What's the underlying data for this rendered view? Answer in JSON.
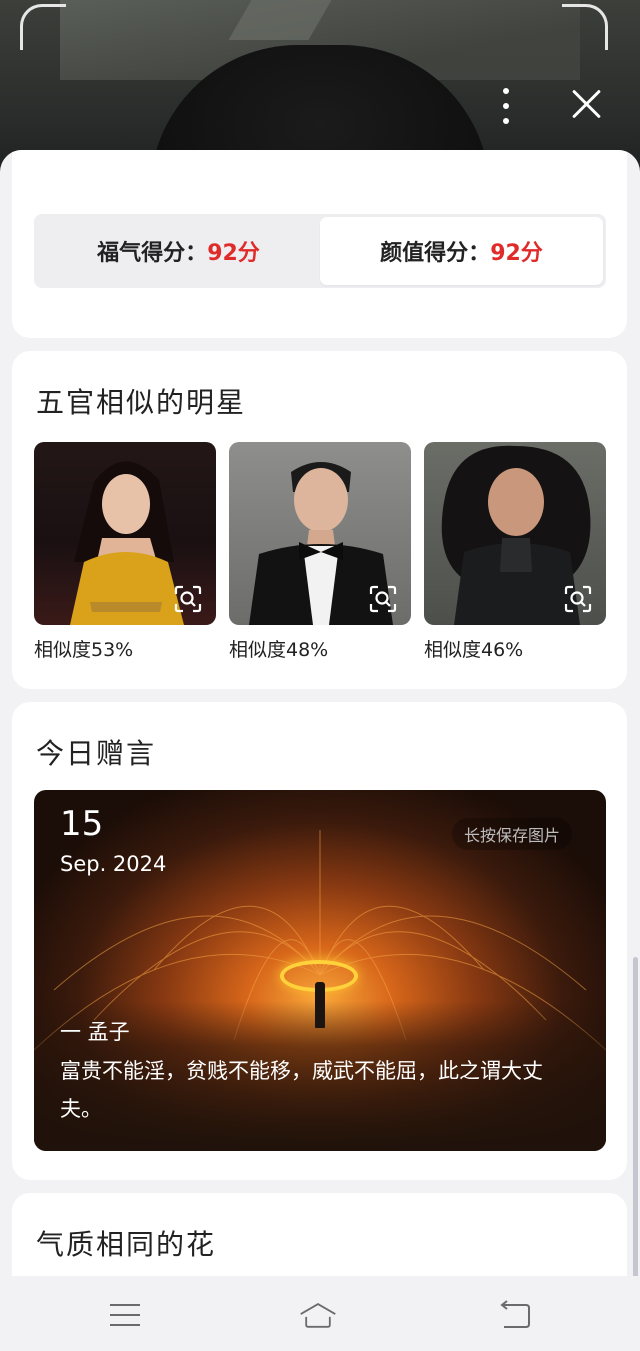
{
  "scores": {
    "fortune": {
      "label": "福气得分：",
      "value": "92分"
    },
    "looks": {
      "label": "颜值得分：",
      "value": "92分"
    }
  },
  "stars_section": {
    "title": "五官相似的明星",
    "items": [
      {
        "similarity": "相似度53%"
      },
      {
        "similarity": "相似度48%"
      },
      {
        "similarity": "相似度46%"
      }
    ]
  },
  "quote_section": {
    "title": "今日赠言",
    "day": "15",
    "month_year": "Sep. 2024",
    "save_hint": "长按保存图片",
    "author": "一 孟子",
    "text": "富贵不能淫，贫贱不能移，威武不能屈，此之谓大丈夫。"
  },
  "flower_section": {
    "title": "气质相同的花"
  },
  "colors": {
    "accent_red": "#e02b2b",
    "background": "#f2f2f4",
    "card": "#ffffff"
  }
}
